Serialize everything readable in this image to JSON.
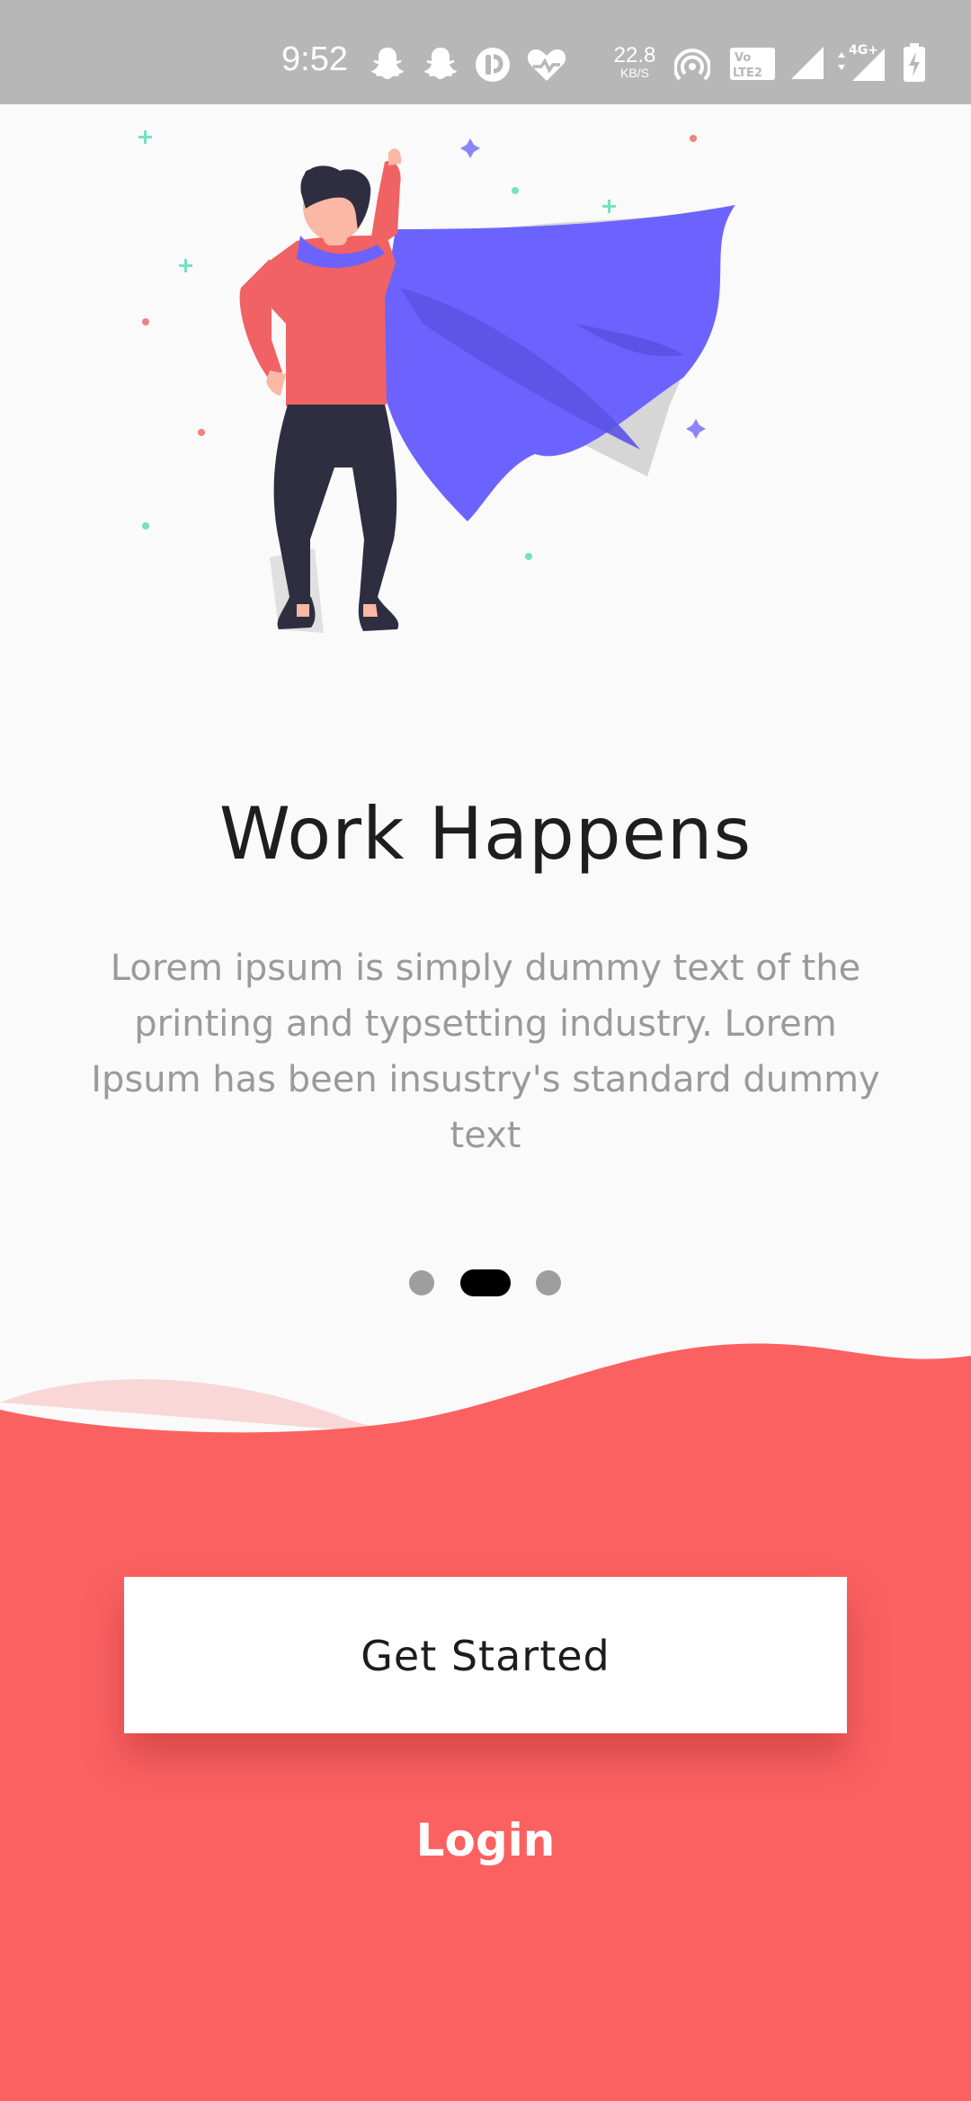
{
  "status_bar": {
    "time": "9:52",
    "net_speed_value": "22.8",
    "net_speed_unit": "KB/S",
    "icons": [
      "snapchat-icon",
      "snapchat-icon",
      "app-icon",
      "health-heart-icon",
      "hotspot-icon",
      "volte-icon",
      "signal-icon",
      "4g-signal-icon",
      "battery-charging-icon"
    ]
  },
  "onboarding": {
    "title": "Work Happens",
    "description": "Lorem ipsum is simply dummy text of the printing and typsetting industry. Lorem Ipsum has been insustry's standard dummy text",
    "pager": {
      "total": 3,
      "active_index": 1
    }
  },
  "actions": {
    "primary_label": "Get Started",
    "secondary_label": "Login"
  },
  "colors": {
    "accent": "#fb6161",
    "cape": "#6c63ff",
    "background": "#fafafa",
    "status_bar": "#b7b7b7"
  }
}
